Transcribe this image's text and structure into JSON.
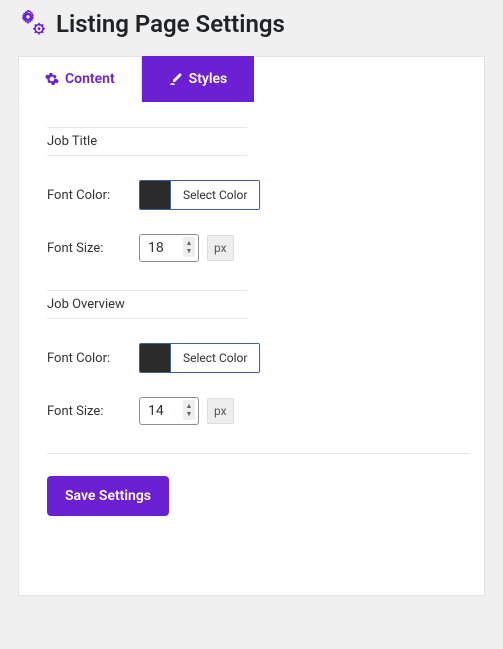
{
  "page_title": "Listing Page Settings",
  "tabs": {
    "content": {
      "label": "Content"
    },
    "styles": {
      "label": "Styles"
    }
  },
  "sections": {
    "job_title": {
      "heading": "Job Title",
      "font_color": {
        "label": "Font Color:",
        "button": "Select Color",
        "value": "#2b2b2b"
      },
      "font_size": {
        "label": "Font Size:",
        "value": "18",
        "unit": "px"
      }
    },
    "job_overview": {
      "heading": "Job Overview",
      "font_color": {
        "label": "Font Color:",
        "button": "Select Color",
        "value": "#2b2b2b"
      },
      "font_size": {
        "label": "Font Size:",
        "value": "14",
        "unit": "px"
      }
    }
  },
  "buttons": {
    "save": "Save Settings"
  }
}
